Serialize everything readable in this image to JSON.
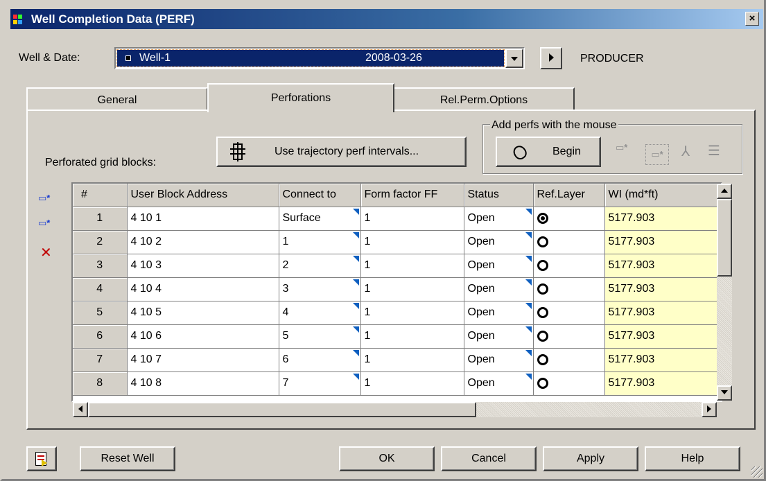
{
  "window": {
    "title": "Well Completion Data (PERF)",
    "close_glyph": "×"
  },
  "well_row": {
    "label": "Well & Date:",
    "selected_well": "Well-1",
    "selected_date": "2008-03-26",
    "well_type": "PRODUCER"
  },
  "tabs": [
    {
      "label": "General",
      "active": false
    },
    {
      "label": "Perforations",
      "active": true
    },
    {
      "label": "Rel.Perm.Options",
      "active": false
    }
  ],
  "perforations": {
    "blocks_label": "Perforated grid blocks:",
    "trajectory_button": "Use trajectory perf intervals...",
    "mouse_group_label": "Add perfs with the mouse",
    "begin_button": "Begin"
  },
  "grid": {
    "columns": [
      "#",
      "User Block Address",
      "Connect to",
      "Form factor FF",
      "Status",
      "Ref.Layer",
      "WI (md*ft)"
    ],
    "rows": [
      {
        "n": "1",
        "address": "4 10 1",
        "connect": "Surface",
        "ff": "1",
        "status": "Open",
        "ref": true,
        "wi": "5177.903"
      },
      {
        "n": "2",
        "address": "4 10 2",
        "connect": "1",
        "ff": "1",
        "status": "Open",
        "ref": false,
        "wi": "5177.903"
      },
      {
        "n": "3",
        "address": "4 10 3",
        "connect": "2",
        "ff": "1",
        "status": "Open",
        "ref": false,
        "wi": "5177.903"
      },
      {
        "n": "4",
        "address": "4 10 4",
        "connect": "3",
        "ff": "1",
        "status": "Open",
        "ref": false,
        "wi": "5177.903"
      },
      {
        "n": "5",
        "address": "4 10 5",
        "connect": "4",
        "ff": "1",
        "status": "Open",
        "ref": false,
        "wi": "5177.903"
      },
      {
        "n": "6",
        "address": "4 10 6",
        "connect": "5",
        "ff": "1",
        "status": "Open",
        "ref": false,
        "wi": "5177.903"
      },
      {
        "n": "7",
        "address": "4 10 7",
        "connect": "6",
        "ff": "1",
        "status": "Open",
        "ref": false,
        "wi": "5177.903"
      },
      {
        "n": "8",
        "address": "4 10 8",
        "connect": "7",
        "ff": "1",
        "status": "Open",
        "ref": false,
        "wi": "5177.903"
      }
    ]
  },
  "footer": {
    "reset_button": "Reset Well",
    "ok_button": "OK",
    "cancel_button": "Cancel",
    "apply_button": "Apply",
    "help_button": "Help"
  },
  "colors": {
    "title_bar": "#0a246a",
    "selection": "#0a246a",
    "wi_cell": "#ffffc8",
    "dropdown_marker": "#1060c0",
    "delete_icon": "#c00000"
  }
}
